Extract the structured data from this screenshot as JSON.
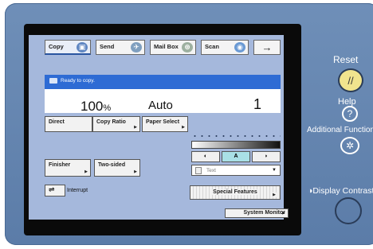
{
  "tabs": {
    "copy": "Copy",
    "send": "Send",
    "mailbox": "Mail Box",
    "scan": "Scan",
    "arrow": "→"
  },
  "status": {
    "message": "Ready to copy."
  },
  "settings": {
    "ratio": "100",
    "ratio_unit": "%",
    "paper": "Auto",
    "quantity": "1"
  },
  "buttons": {
    "direct": "Direct",
    "copy_ratio": "Copy Ratio",
    "paper_select": "Paper Select",
    "finisher": "Finisher",
    "two_sided": "Two-sided",
    "interrupt_label": "Interrupt",
    "special_features": "Special Features",
    "system_monitor": "System Monitor"
  },
  "density": {
    "light": "◐",
    "auto": "A",
    "dark": "◗"
  },
  "text_mode": {
    "selected": "Text"
  },
  "hardware": {
    "reset": "Reset",
    "help": "Help",
    "additional_functions": "Additional Functions",
    "display_contrast": "◑Display Contrast"
  },
  "icons": {
    "copy_tab": "copy-icon",
    "send_tab": "send-icon",
    "mailbox_tab": "mailbox-icon",
    "scan_tab": "scan-icon"
  },
  "colors": {
    "panel": "#5f80ad",
    "screen": "#a5b8dc",
    "status_bar": "#2e6bd4",
    "reset_button": "#f1e48e"
  }
}
